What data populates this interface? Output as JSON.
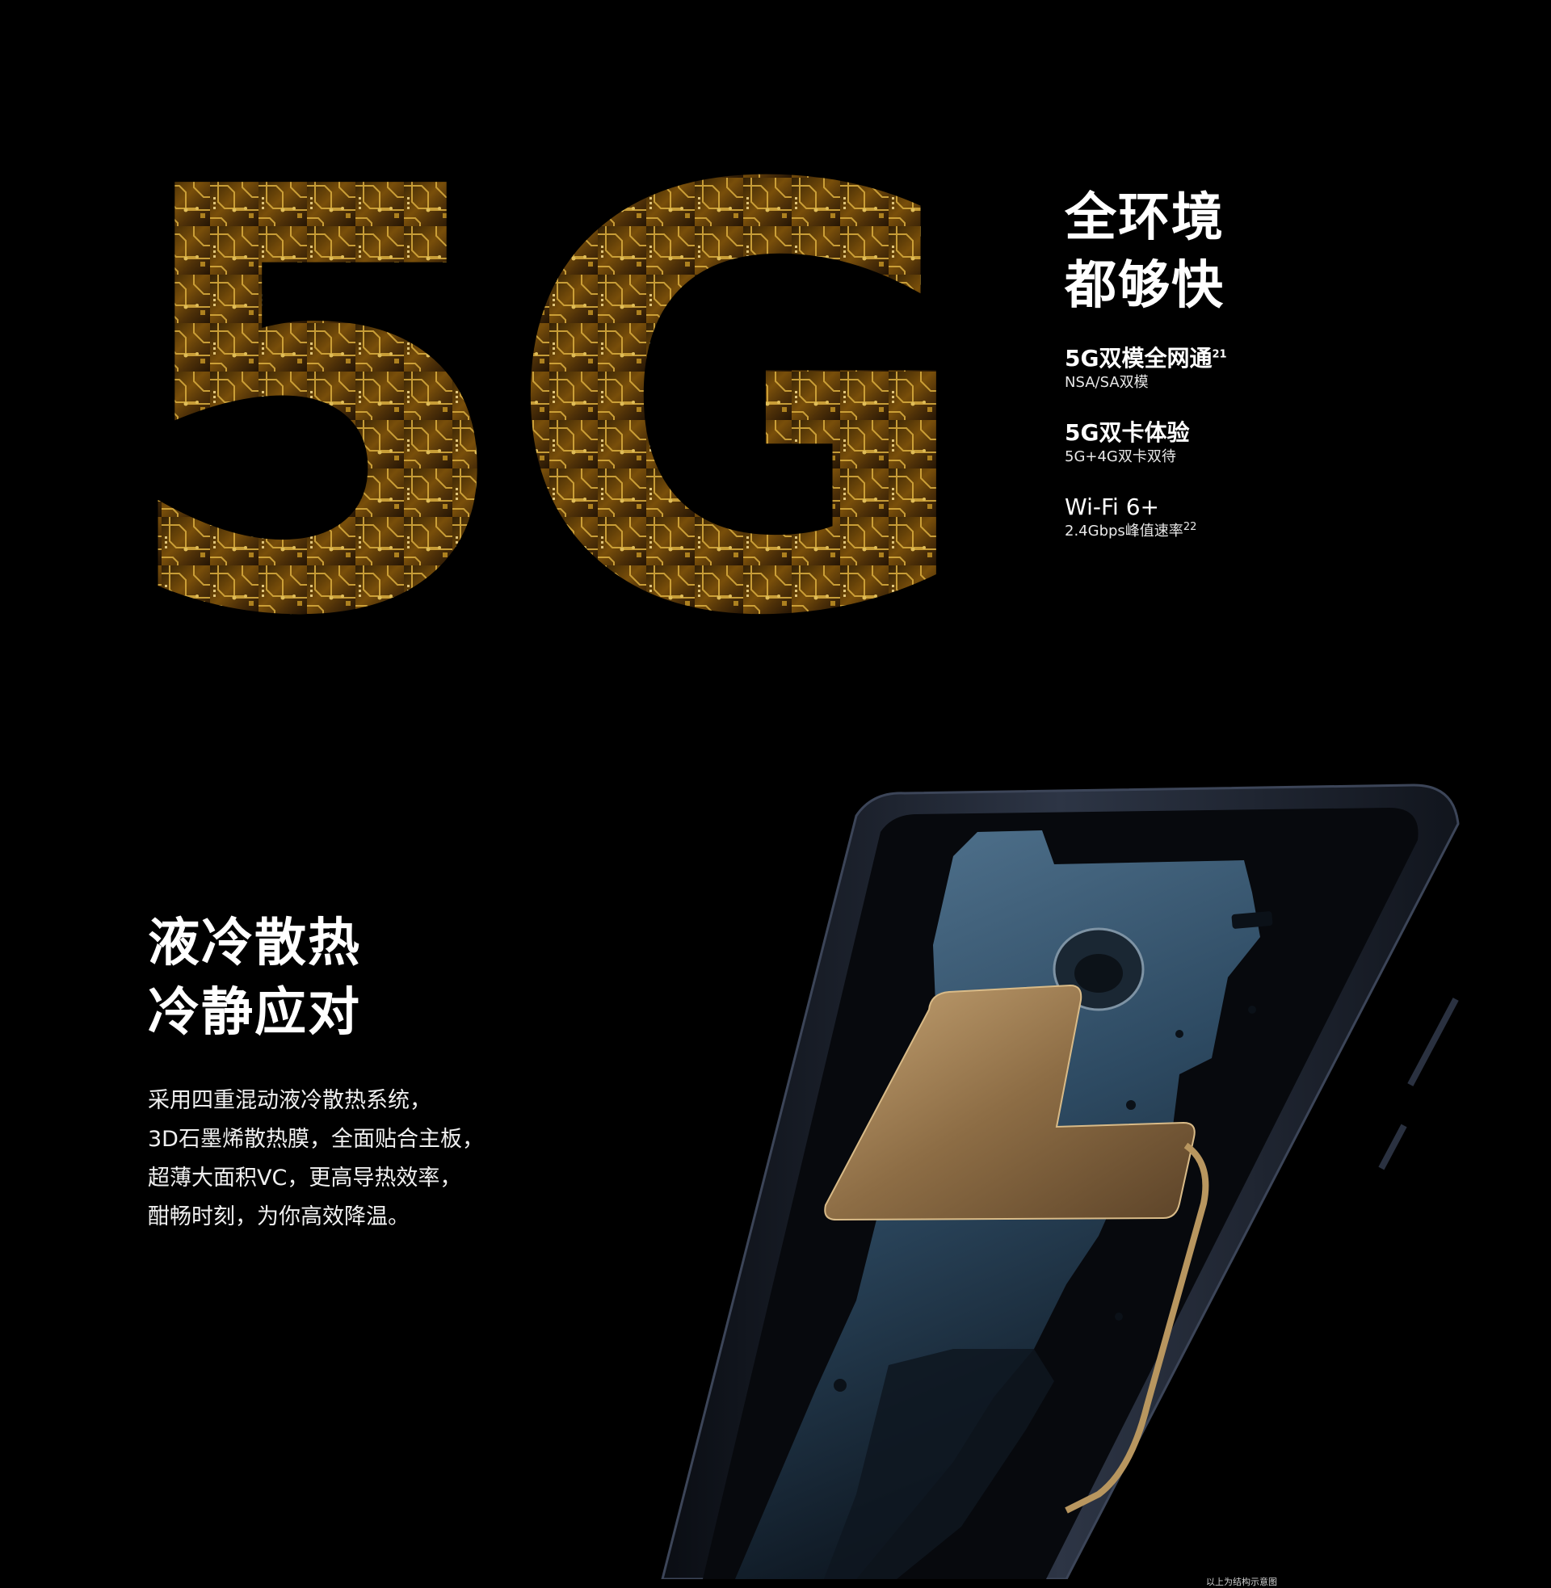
{
  "network": {
    "big_text": "5G",
    "headline_lines": [
      "全环境",
      "都够快"
    ],
    "specs": [
      {
        "title": "5G双模全网通",
        "title_sup": "21",
        "sub": "NSA/SA双模",
        "sub_sup": ""
      },
      {
        "title": "5G双卡体验",
        "title_sup": "",
        "sub": "5G+4G双卡双待",
        "sub_sup": ""
      },
      {
        "title": "Wi-Fi 6+",
        "title_sup": "",
        "sub": "2.4Gbps峰值速率",
        "sub_sup": "22"
      }
    ]
  },
  "cooling": {
    "headline_lines": [
      "液冷散热",
      "冷静应对"
    ],
    "body_lines": [
      "采用四重混动液冷散热系统，",
      "3D石墨烯散热膜，全面贴合主板，",
      "超薄大面积VC，更高导热效率，",
      "酣畅时刻，为你高效降温。"
    ],
    "footnote": "以上为结构示意图"
  },
  "colors": {
    "background": "#000000",
    "circuit_gold": "#d9a21a",
    "circuit_dark": "#2a1a05",
    "frame": "#1d2330",
    "plate_blue": "#3d5f7a",
    "copper": "#b7925e"
  }
}
